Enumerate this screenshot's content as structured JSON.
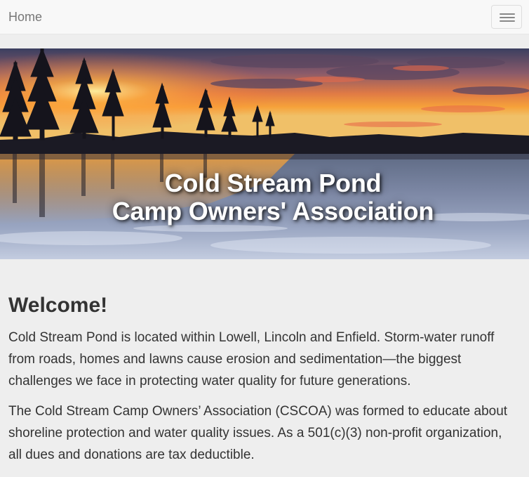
{
  "navbar": {
    "brand": "Home",
    "toggle_icon": "hamburger-menu-icon"
  },
  "hero": {
    "image": "sunset-over-frozen-pond",
    "title_line1": "Cold Stream Pond",
    "title_line2": "Camp Owners' Association"
  },
  "main": {
    "heading": "Welcome!",
    "paragraphs": [
      "Cold Stream Pond is located within Lowell, Lincoln and Enfield. Storm-water runoff from roads, homes and lawns cause erosion and sedimentation—the biggest challenges we face in protecting water quality for future generations.",
      "The Cold Stream Camp Owners’ Association (CSCOA) was formed to educate about shoreline protection and water quality issues. As a 501(c)(3) non-profit organization, all dues and donations are tax deductible."
    ]
  },
  "colors": {
    "navbar_bg": "#f8f8f8",
    "brand_text": "#777777",
    "page_bg": "#eeeeee",
    "body_text": "#333333",
    "hero_title": "#ffffff"
  }
}
